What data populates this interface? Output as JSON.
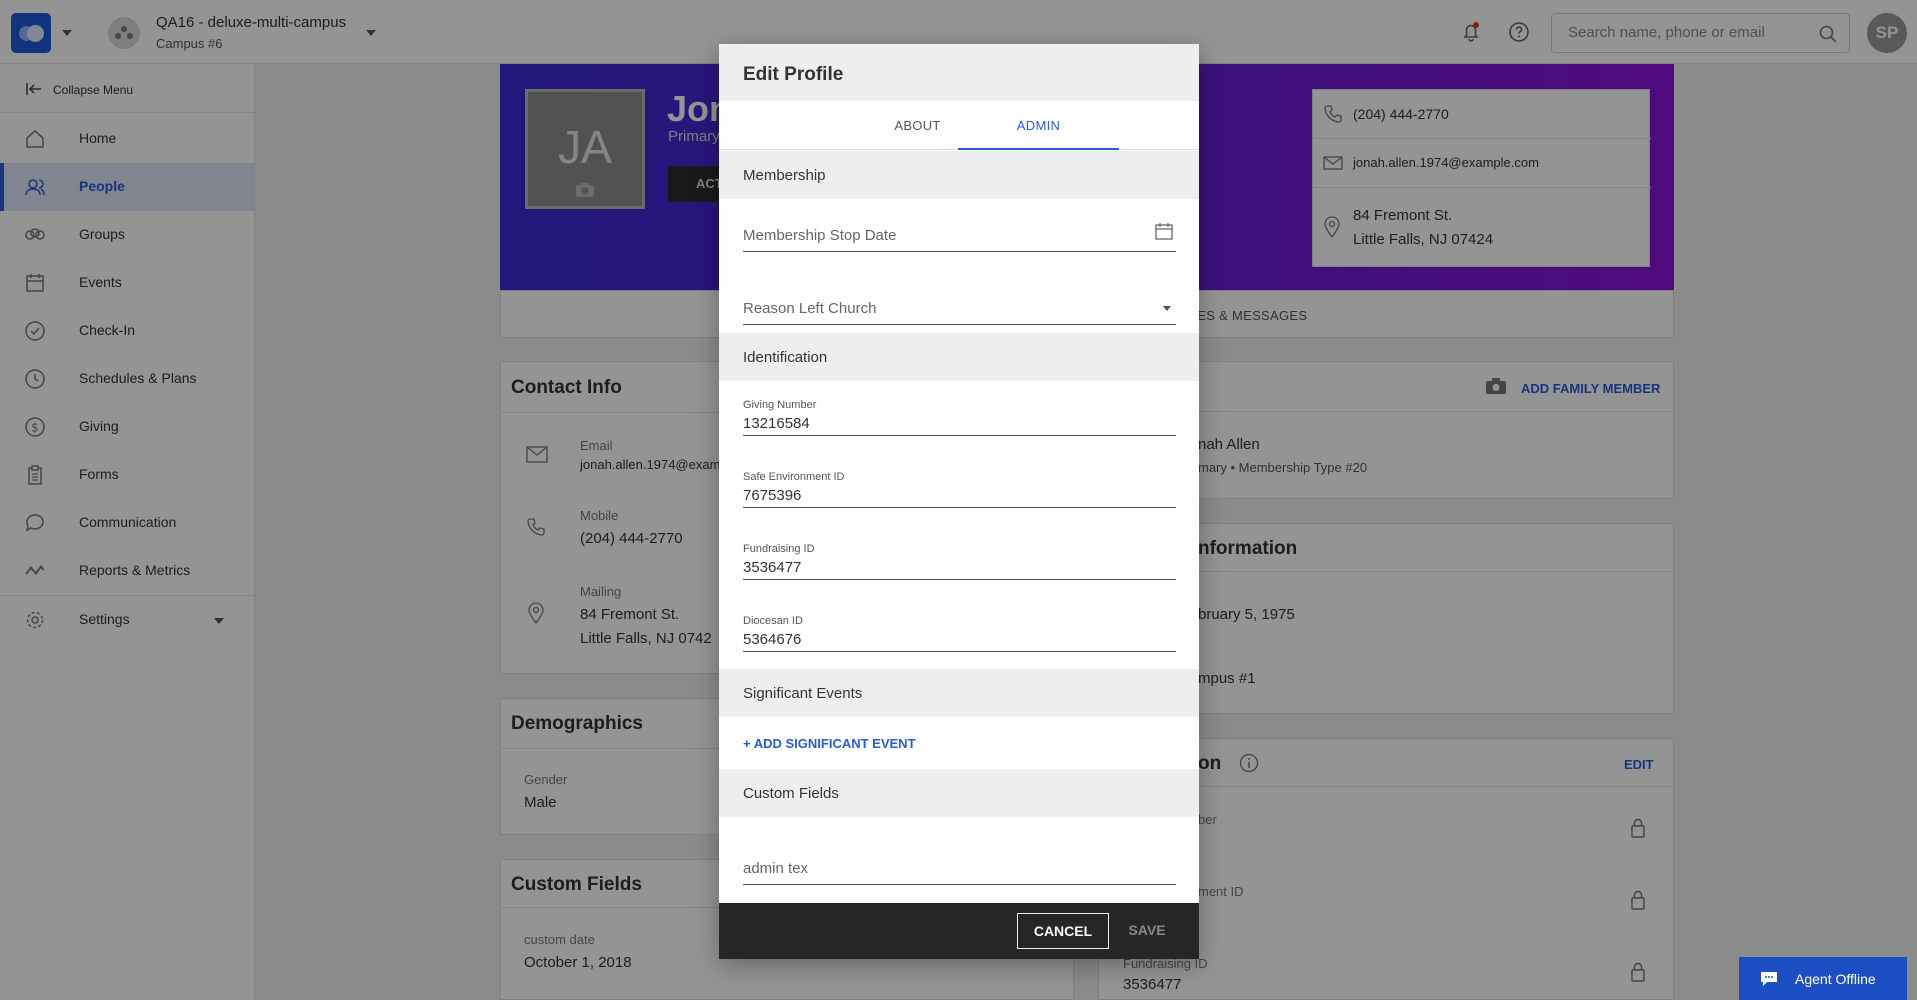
{
  "topbar": {
    "org_name": "QA16 - deluxe-multi-campus",
    "campus": "Campus #6",
    "search_placeholder": "Search name, phone or email",
    "user_initials": "SP"
  },
  "sidebar": {
    "collapse_label": "Collapse Menu",
    "items": [
      {
        "label": "Home",
        "icon": "home-icon"
      },
      {
        "label": "People",
        "icon": "people-icon",
        "active": true
      },
      {
        "label": "Groups",
        "icon": "groups-icon"
      },
      {
        "label": "Events",
        "icon": "calendar-icon"
      },
      {
        "label": "Check-In",
        "icon": "check-circle-icon"
      },
      {
        "label": "Schedules & Plans",
        "icon": "clock-icon"
      },
      {
        "label": "Giving",
        "icon": "dollar-icon"
      },
      {
        "label": "Forms",
        "icon": "clipboard-icon"
      },
      {
        "label": "Communication",
        "icon": "chat-icon"
      },
      {
        "label": "Reports & Metrics",
        "icon": "chart-icon"
      },
      {
        "label": "Settings",
        "icon": "gear-icon"
      }
    ]
  },
  "profile": {
    "initials": "JA",
    "name_partial": "Jon",
    "role_partial": "Primary",
    "action_partial": "ACT",
    "phone": "(204) 444-2770",
    "email": "jonah.allen.1974@example.com",
    "address_line1": "84 Fremont St.",
    "address_line2": "Little Falls, NJ 07424",
    "tabs_partial": "TES & MESSAGES"
  },
  "contact_card": {
    "title": "Contact Info",
    "email_label": "Email",
    "email_value": "jonah.allen.1974@exam",
    "mobile_label": "Mobile",
    "mobile_value": "(204) 444-2770",
    "mailing_label": "Mailing",
    "mailing_line1": "84 Fremont St.",
    "mailing_line2": "Little Falls, NJ 0742"
  },
  "demographics_card": {
    "title": "Demographics",
    "gender_label": "Gender",
    "gender_value": "Male"
  },
  "custom_card": {
    "title": "Custom Fields",
    "date_label": "custom date",
    "date_value": "October 1, 2018"
  },
  "family_card": {
    "add_label": "ADD FAMILY MEMBER",
    "member_name": "nah Allen",
    "member_meta": "mary • Membership Type #20"
  },
  "info_card": {
    "title": "nformation",
    "birthday": "bruary 5, 1975",
    "campus": "mpus #1"
  },
  "admin_card": {
    "title": "on",
    "edit_label": "EDIT",
    "label1": "ber",
    "label2": "ment ID",
    "label3": "Fundraising ID",
    "value3": "3536477"
  },
  "modal": {
    "title": "Edit Profile",
    "tab_about": "ABOUT",
    "tab_admin": "ADMIN",
    "membership_header": "Membership",
    "membership_stop_placeholder": "Membership Stop Date",
    "reason_left_placeholder": "Reason Left Church",
    "identification_header": "Identification",
    "giving_label": "Giving Number",
    "giving_value": "13216584",
    "safe_env_label": "Safe Environment ID",
    "safe_env_value": "7675396",
    "fundraising_label": "Fundraising ID",
    "fundraising_value": "3536477",
    "diocesan_label": "Diocesan ID",
    "diocesan_value": "5364676",
    "events_header": "Significant Events",
    "add_event_label": "+ ADD SIGNIFICANT EVENT",
    "custom_header": "Custom Fields",
    "admin_text_placeholder": "admin tex",
    "cancel_label": "CANCEL",
    "save_label": "SAVE"
  },
  "chat": {
    "label": "Agent Offline"
  },
  "colors": {
    "accent": "#2a5bd7",
    "hero_start": "#3a2ad4",
    "hero_end": "#8a12d8",
    "footer": "#262626"
  }
}
